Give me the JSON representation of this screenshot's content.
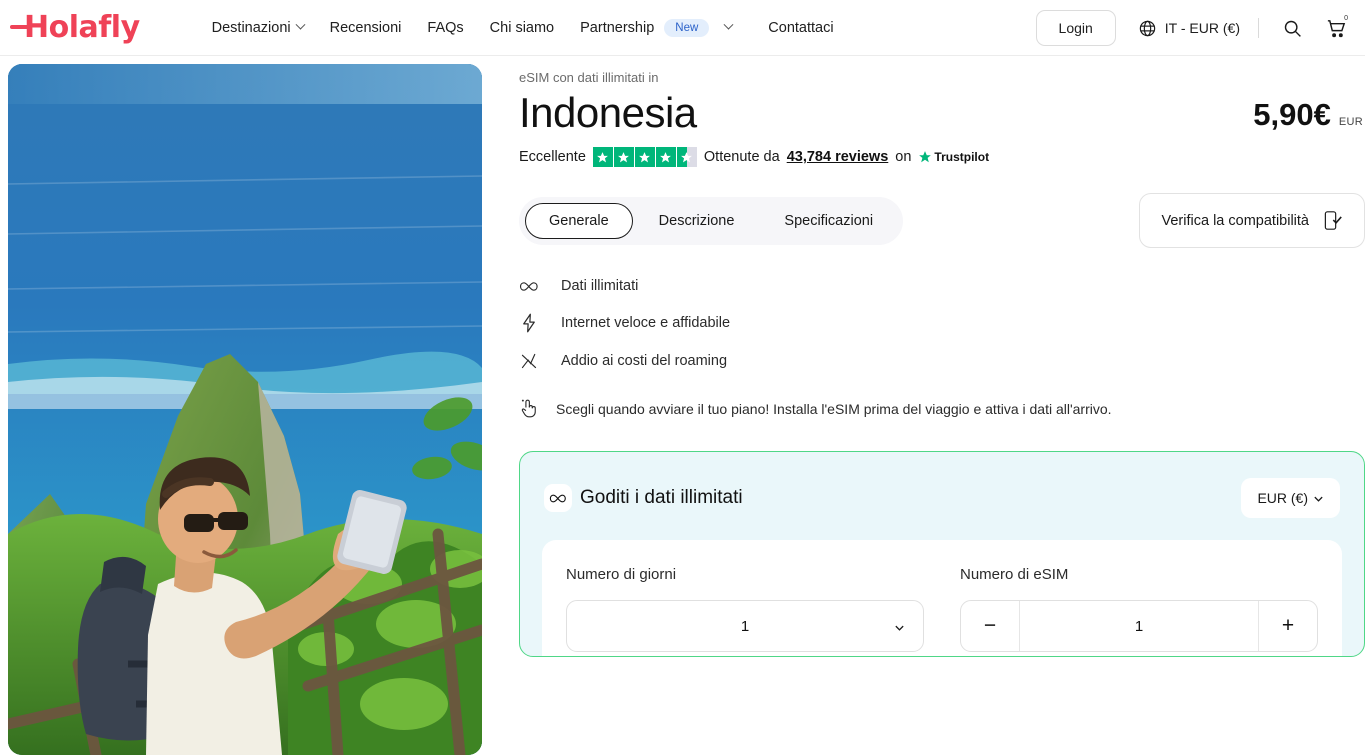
{
  "header": {
    "logo_text": "Holafly",
    "nav": [
      {
        "label": "Destinazioni",
        "has_chevron": true,
        "badge": null
      },
      {
        "label": "Recensioni",
        "has_chevron": false,
        "badge": null
      },
      {
        "label": "FAQs",
        "has_chevron": false,
        "badge": null
      },
      {
        "label": "Chi siamo",
        "has_chevron": false,
        "badge": null
      },
      {
        "label": "Partnership",
        "has_chevron": true,
        "badge": "New"
      },
      {
        "label": "Contattaci",
        "has_chevron": false,
        "badge": null
      }
    ],
    "login_label": "Login",
    "locale_label": "IT - EUR (€)",
    "cart_count": "0",
    "icons": {
      "globe": "globe-icon",
      "search": "search-icon",
      "cart": "cart-icon"
    }
  },
  "product": {
    "eyebrow": "eSIM con dati illimitati in",
    "title": "Indonesia",
    "price": "5,90€",
    "price_currency": "EUR"
  },
  "trustpilot": {
    "rating_word": "Eccellente",
    "stars_full": 4,
    "stars_half": true,
    "reviews_prefix": "Ottenute da",
    "reviews_count": "43,784 reviews",
    "on_word": "on",
    "brand": "Trustpilot",
    "star_color": "#00b67a"
  },
  "tabs": [
    {
      "label": "Generale",
      "active": true
    },
    {
      "label": "Descrizione",
      "active": false
    },
    {
      "label": "Specificazioni",
      "active": false
    }
  ],
  "compatibility": {
    "label": "Verifica la compatibilità",
    "icon": "phone-check-icon"
  },
  "features": [
    {
      "icon": "infinity-icon",
      "label": "Dati illimitati"
    },
    {
      "icon": "lightning-icon",
      "label": "Internet veloce e affidabile"
    },
    {
      "icon": "no-roaming-icon",
      "label": "Addio ai costi del roaming"
    }
  ],
  "note": {
    "icon": "tap-hand-icon",
    "text": "Scegli quando avviare il tuo piano! Installa l'eSIM prima del viaggio e attiva i dati all'arrivo."
  },
  "plan": {
    "icon": "infinity-icon",
    "title": "Goditi i dati illimitati",
    "currency_select": "EUR (€)",
    "border_color": "#4fd787",
    "background_color": "#eaf7fa",
    "fields": {
      "days": {
        "label": "Numero di giorni",
        "value": "1"
      },
      "esim": {
        "label": "Numero di eSIM",
        "value": "1",
        "minus": "−",
        "plus": "+"
      }
    }
  },
  "hero": {
    "alt": "Uomo con zaino che si fa un selfie su una scogliera tropicale sopra il mare"
  }
}
